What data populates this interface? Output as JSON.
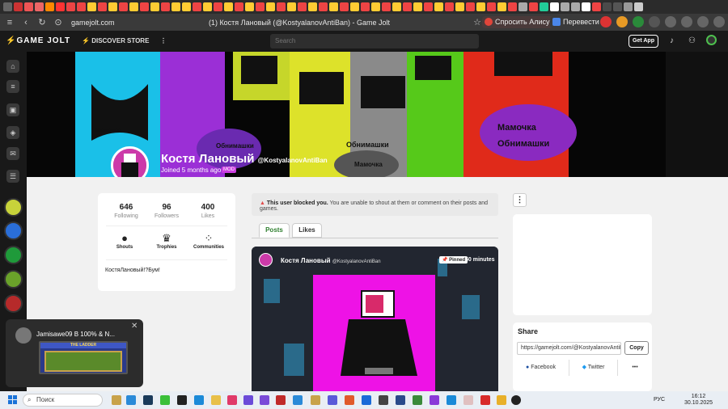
{
  "browser": {
    "url": "gamejolt.com",
    "page_title": "(1) Костя Лановый (@KostyalanovAntiBan) - Game Jolt",
    "alice_button": "Спросить Алису AI",
    "translate_button": "Перевести"
  },
  "site_header": {
    "logo": "GAME JOLT",
    "discover": "DISCOVER",
    "store": "STORE",
    "search_placeholder": "Search",
    "get_app": "Get App"
  },
  "banner": {
    "text_mamochka": "Мамочка",
    "text_obnimashki": "Обнимашки"
  },
  "profile": {
    "display_name": "Костя Лановый",
    "username": "@KostyalanovAntiBan",
    "joined": "Joined 5 months ago",
    "badge": "MOD"
  },
  "stats": {
    "following_count": "646",
    "following_label": "Following",
    "followers_count": "96",
    "followers_label": "Followers",
    "likes_count": "400",
    "likes_label": "Likes"
  },
  "actions": {
    "shouts": "Shouts",
    "trophies": "Trophies",
    "communities": "Communities"
  },
  "bio": "КостяЛановый!?Бум!",
  "blocked_notice": {
    "bold": "This user blocked you.",
    "text": "You are unable to shout at them or comment on their posts and games."
  },
  "tabs": {
    "posts": "Posts",
    "likes": "Likes"
  },
  "post": {
    "author": "Костя Лановый",
    "username": "@KostyalanovAntiBan",
    "pinned": "Pinned",
    "time": "50 minutes"
  },
  "share": {
    "title": "Share",
    "url": "https://gamejolt.com/@KostyalanovAntiBan",
    "copy": "Copy",
    "facebook": "Facebook",
    "twitter": "Twitter",
    "more": "•••"
  },
  "notification": {
    "text": "Jamisawe09 В 100% & N...",
    "game_title": "THE LADDER"
  },
  "taskbar": {
    "search": "Поиск",
    "lang": "РУС",
    "time": "16:12",
    "date": "30.10.2025"
  },
  "colors": {
    "accent_green": "#2f7f2f",
    "mod_badge": "#cc3ee0",
    "avatar_pink": "#cc3aa9"
  }
}
